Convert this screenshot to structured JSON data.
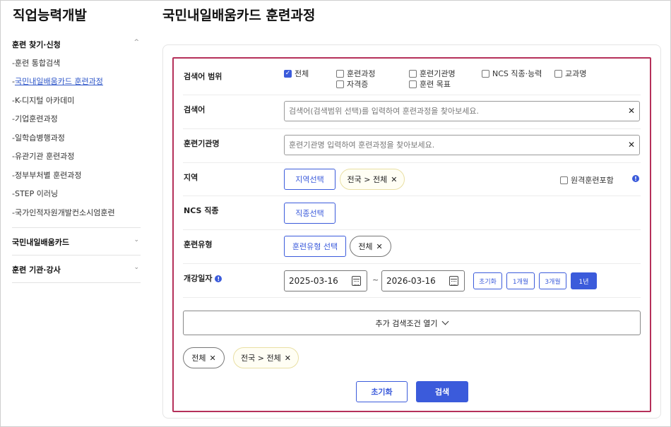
{
  "sidebar": {
    "title": "직업능력개발",
    "sections": [
      {
        "label": "훈련 찾기·신청",
        "chevron": "^"
      },
      {
        "label": "국민내일배움카드",
        "chevron": "⌄"
      },
      {
        "label": "훈련 기관·강사",
        "chevron": "⌄"
      }
    ],
    "items": [
      {
        "label": "-훈련 통합검색"
      },
      {
        "label": "국민내일배움카드 훈련과정",
        "prefix": "-"
      },
      {
        "label": "-K-디지털 아카데미"
      },
      {
        "label": "-기업훈련과정"
      },
      {
        "label": "-일학습병행과정"
      },
      {
        "label": "-유관기관 훈련과정"
      },
      {
        "label": "-정부부처별 훈련과정"
      },
      {
        "label": "-STEP 이러닝"
      },
      {
        "label": "-국가인적자원개발컨소시엄훈련"
      }
    ]
  },
  "main": {
    "title": "국민내일배움카드 훈련과정"
  },
  "form": {
    "scope": {
      "label": "검색어 범위",
      "options": [
        {
          "label": "전체",
          "checked": true
        },
        {
          "label": "훈련과정",
          "checked": false
        },
        {
          "label": "훈련기관명",
          "checked": false
        },
        {
          "label": "NCS 직종·능력",
          "checked": false
        },
        {
          "label": "교과명",
          "checked": false
        },
        {
          "label": "자격증",
          "checked": false
        },
        {
          "label": "훈련 목표",
          "checked": false
        }
      ]
    },
    "keyword": {
      "label": "검색어",
      "placeholder": "검색어(검색범위 선택)를 입력하여 훈련과정을 찾아보세요.",
      "value": ""
    },
    "institution": {
      "label": "훈련기관명",
      "placeholder": "훈련기관명 입력하여 훈련과정을 찾아보세요.",
      "value": ""
    },
    "region": {
      "label": "지역",
      "button": "지역선택",
      "chip": "전국 > 전체",
      "remote_label": "원격훈련포함",
      "remote_checked": false
    },
    "ncs": {
      "label": "NCS 직종",
      "button": "직종선택"
    },
    "type": {
      "label": "훈련유형",
      "button": "훈련유형 선택",
      "chip": "전체"
    },
    "date": {
      "label": "개강일자",
      "start": "2025-03-16",
      "separator": "~",
      "end": "2026-03-16",
      "periods": [
        {
          "label": "초기화",
          "active": false
        },
        {
          "label": "1개월",
          "active": false
        },
        {
          "label": "3개월",
          "active": false
        },
        {
          "label": "1년",
          "active": true
        }
      ]
    },
    "more_button": "추가 검색조건 열기",
    "selected_chips": [
      "전체",
      "전국 > 전체"
    ],
    "reset_button": "초기화",
    "search_button": "검색"
  },
  "colors": {
    "accent": "#3b5bdb",
    "highlight_border": "#b5305a"
  }
}
